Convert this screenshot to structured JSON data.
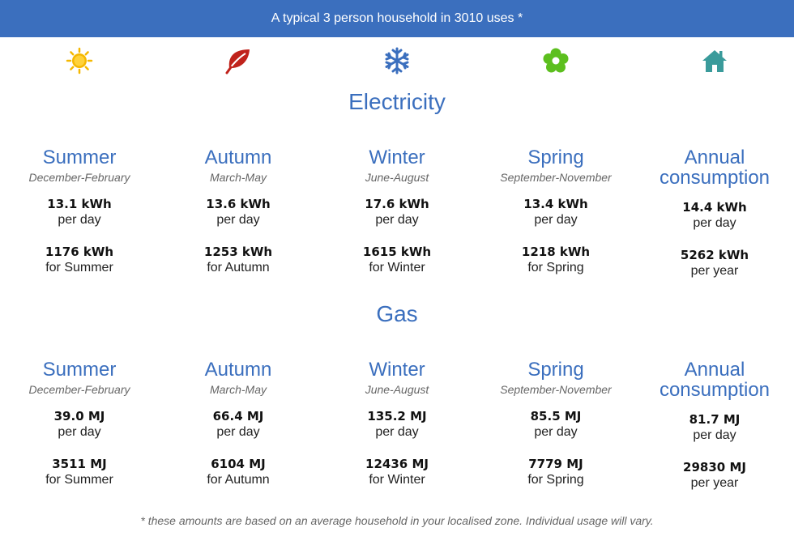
{
  "banner": {
    "text": "A typical 3 person household in 3010 uses *"
  },
  "icons": [
    {
      "name": "sun-icon",
      "color": "#f5b800"
    },
    {
      "name": "leaf-icon",
      "color": "#c0221b"
    },
    {
      "name": "snowflake-icon",
      "color": "#3b6fbe"
    },
    {
      "name": "flower-icon",
      "color": "#5cbf1e"
    },
    {
      "name": "house-icon",
      "color": "#3a9b9b"
    }
  ],
  "colors": {
    "accent": "#3b6fbe",
    "banner_bg": "#3b6fbe"
  },
  "electricity": {
    "title": "Electricity",
    "columns": [
      {
        "season": "Summer",
        "months": "December-February",
        "daily": "13.1 kWh",
        "daily_unit": "per day",
        "total": "1176 kWh",
        "total_unit": "for Summer"
      },
      {
        "season": "Autumn",
        "months": "March-May",
        "daily": "13.6 kWh",
        "daily_unit": "per day",
        "total": "1253 kWh",
        "total_unit": "for Autumn"
      },
      {
        "season": "Winter",
        "months": "June-August",
        "daily": "17.6 kWh",
        "daily_unit": "per day",
        "total": "1615 kWh",
        "total_unit": "for Winter"
      },
      {
        "season": "Spring",
        "months": "September-November",
        "daily": "13.4 kWh",
        "daily_unit": "per day",
        "total": "1218 kWh",
        "total_unit": "for Spring"
      },
      {
        "season_line1": "Annual",
        "season_line2": "consumption",
        "daily": "14.4 kWh",
        "daily_unit": "per day",
        "total": "5262 kWh",
        "total_unit": "per year"
      }
    ]
  },
  "gas": {
    "title": "Gas",
    "columns": [
      {
        "season": "Summer",
        "months": "December-February",
        "daily": "39.0 MJ",
        "daily_unit": "per day",
        "total": "3511 MJ",
        "total_unit": "for Summer"
      },
      {
        "season": "Autumn",
        "months": "March-May",
        "daily": "66.4 MJ",
        "daily_unit": "per day",
        "total": "6104 MJ",
        "total_unit": "for Autumn"
      },
      {
        "season": "Winter",
        "months": "June-August",
        "daily": "135.2 MJ",
        "daily_unit": "per day",
        "total": "12436 MJ",
        "total_unit": "for Winter"
      },
      {
        "season": "Spring",
        "months": "September-November",
        "daily": "85.5 MJ",
        "daily_unit": "per day",
        "total": "7779 MJ",
        "total_unit": "for Spring"
      },
      {
        "season_line1": "Annual",
        "season_line2": "consumption",
        "daily": "81.7 MJ",
        "daily_unit": "per day",
        "total": "29830 MJ",
        "total_unit": "per year"
      }
    ]
  },
  "footnote": "* these amounts are based on an average household in your localised zone. Individual usage will vary."
}
